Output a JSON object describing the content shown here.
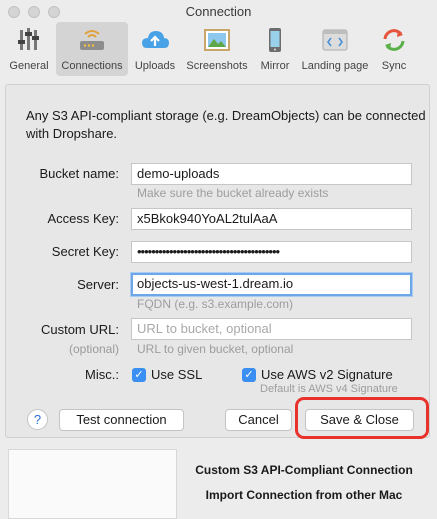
{
  "window": {
    "title": "Connection"
  },
  "toolbar": {
    "tabs": [
      {
        "label": "General",
        "icon": "sliders-icon"
      },
      {
        "label": "Connections",
        "icon": "wifi-router-icon",
        "active": true
      },
      {
        "label": "Uploads",
        "icon": "cloud-upload-icon"
      },
      {
        "label": "Screenshots",
        "icon": "photo-icon"
      },
      {
        "label": "Mirror",
        "icon": "phone-icon"
      },
      {
        "label": "Landing page",
        "icon": "code-window-icon"
      },
      {
        "label": "Sync",
        "icon": "sync-arrows-icon"
      }
    ]
  },
  "form": {
    "intro": "Any S3 API-compliant storage (e.g. DreamObjects) can be connected with Dropshare.",
    "bucket_label": "Bucket name:",
    "bucket_value": "demo-uploads",
    "bucket_hint": "Make sure the bucket already exists",
    "access_label": "Access Key:",
    "access_value": "x5Bkok940YoAL2tulAaA",
    "secret_label": "Secret Key:",
    "secret_value": "••••••••••••••••••••••••••••••••••••••••",
    "server_label": "Server:",
    "server_value": "objects-us-west-1.dream.io",
    "server_hint": "FQDN (e.g. s3.example.com)",
    "custom_label": "Custom URL:",
    "custom_sub_label": "(optional)",
    "custom_placeholder": "URL to bucket, optional",
    "custom_hint": "URL to given bucket, optional",
    "misc_label": "Misc.:",
    "ssl_label": "Use SSL",
    "ssl_checked": true,
    "aws_label": "Use AWS v2 Signature",
    "aws_checked": true,
    "aws_hint": "Default is AWS v4 Signature"
  },
  "buttons": {
    "help": "?",
    "test": "Test connection",
    "cancel": "Cancel",
    "save": "Save & Close"
  },
  "bottom_menu": {
    "items": [
      "Custom S3 API-Compliant Connection",
      "Import Connection from other Mac"
    ]
  },
  "colors": {
    "accent": "#3b8ff3",
    "focus_ring": "#6ea7e8",
    "annotation": "#e8322b",
    "active_tab": "#d4d4d4"
  }
}
